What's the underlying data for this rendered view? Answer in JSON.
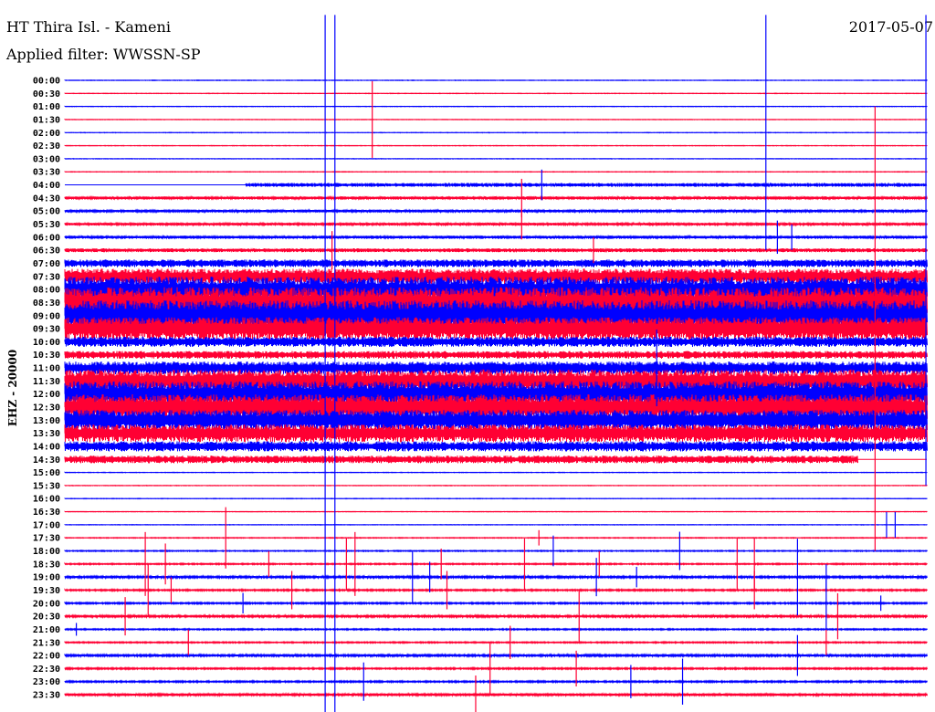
{
  "header": {
    "station": "HT Thira Isl. - Kameni",
    "filter": "Applied filter: WWSSN-SP",
    "date": "2017-05-07"
  },
  "chart_data": {
    "type": "line",
    "title": "HT Thira Isl. - Kameni",
    "subtitle": "Applied filter: WWSSN-SP",
    "ylabel": "EHZ - 20000",
    "x_range_minutes": [
      0,
      30
    ],
    "colors": [
      "#0000ff",
      "#ff0033"
    ],
    "row_labels": [
      "00:00",
      "00:30",
      "01:00",
      "01:30",
      "02:00",
      "02:30",
      "03:00",
      "03:30",
      "04:00",
      "04:30",
      "05:00",
      "05:30",
      "06:00",
      "06:30",
      "07:00",
      "07:30",
      "08:00",
      "08:30",
      "09:00",
      "09:30",
      "10:00",
      "10:30",
      "11:00",
      "11:30",
      "12:00",
      "12:30",
      "13:00",
      "13:30",
      "14:00",
      "14:30",
      "15:00",
      "15:30",
      "16:00",
      "16:30",
      "17:00",
      "17:30",
      "18:00",
      "18:30",
      "19:00",
      "19:30",
      "20:00",
      "20:30",
      "21:00",
      "21:30",
      "22:00",
      "22:30",
      "23:00",
      "23:30"
    ],
    "noise_amplitude": [
      0.02,
      0.02,
      0.02,
      0.02,
      0.02,
      0.02,
      0.02,
      0.02,
      0.15,
      0.12,
      0.1,
      0.1,
      0.12,
      0.15,
      0.3,
      0.6,
      1.0,
      1.2,
      1.2,
      0.9,
      0.4,
      0.3,
      0.5,
      0.9,
      1.0,
      1.0,
      0.8,
      0.7,
      0.4,
      0.3,
      0.02,
      0.02,
      0.02,
      0.02,
      0.02,
      0.03,
      0.04,
      0.05,
      0.08,
      0.06,
      0.06,
      0.08,
      0.05,
      0.05,
      0.08,
      0.06,
      0.06,
      0.1
    ],
    "noisy_span_minutes": {
      "8": [
        6.3,
        30
      ],
      "29": [
        0,
        27.6
      ]
    },
    "long_signals": [
      {
        "minute": 9.06,
        "from_row": -5,
        "to_row": 49,
        "color": 0
      },
      {
        "minute": 9.4,
        "from_row": -5,
        "to_row": 49,
        "color": 0
      },
      {
        "minute": 24.4,
        "from_row": -5,
        "to_row": 13,
        "color": 0
      },
      {
        "minute": 29.97,
        "from_row": -5,
        "to_row": 31,
        "color": 0
      },
      {
        "minute": 28.2,
        "from_row": 2,
        "to_row": 36,
        "color": 1
      }
    ],
    "events": [
      [
        3,
        10.7,
        3
      ],
      [
        8,
        16.6,
        1.2
      ],
      [
        9,
        15.9,
        1.5
      ],
      [
        11,
        15.9,
        1.2
      ],
      [
        12,
        24.8,
        1.3
      ],
      [
        12,
        25.3,
        1
      ],
      [
        13,
        9.3,
        1.5
      ],
      [
        13,
        18.4,
        1
      ],
      [
        22,
        20.6,
        3
      ],
      [
        34,
        28.6,
        1
      ],
      [
        34,
        28.9,
        1
      ],
      [
        35,
        5.6,
        2.4
      ],
      [
        35,
        16.5,
        0.6
      ],
      [
        36,
        17.0,
        1.2
      ],
      [
        36,
        21.4,
        1.5
      ],
      [
        37,
        2.8,
        2.5
      ],
      [
        37,
        3.5,
        1.6
      ],
      [
        37,
        7.1,
        1
      ],
      [
        37,
        9.8,
        2
      ],
      [
        37,
        10.1,
        2.5
      ],
      [
        37,
        13.1,
        1.2
      ],
      [
        37,
        16.0,
        2
      ],
      [
        37,
        18.6,
        1
      ],
      [
        37,
        23.4,
        2
      ],
      [
        37,
        24.0,
        2
      ],
      [
        38,
        12.1,
        2
      ],
      [
        38,
        12.7,
        1.2
      ],
      [
        38,
        18.5,
        1.5
      ],
      [
        38,
        19.9,
        0.8
      ],
      [
        38,
        25.5,
        3
      ],
      [
        38,
        26.5,
        1
      ],
      [
        39,
        2.9,
        2
      ],
      [
        39,
        3.7,
        1
      ],
      [
        39,
        7.9,
        1.5
      ],
      [
        39,
        13.3,
        1.5
      ],
      [
        39,
        24.0,
        1.5
      ],
      [
        40,
        6.2,
        0.8
      ],
      [
        40,
        26.5,
        2
      ],
      [
        40,
        28.4,
        0.6
      ],
      [
        41,
        2.1,
        1.5
      ],
      [
        41,
        17.9,
        2
      ],
      [
        41,
        26.9,
        1.8
      ],
      [
        42,
        0.4,
        0.5
      ],
      [
        43,
        4.3,
        1
      ],
      [
        43,
        15.5,
        1.3
      ],
      [
        43,
        26.5,
        1
      ],
      [
        44,
        25.5,
        1.6
      ],
      [
        45,
        14.8,
        2
      ],
      [
        45,
        17.8,
        1.4
      ],
      [
        46,
        10.4,
        1.5
      ],
      [
        46,
        21.5,
        1.8
      ],
      [
        47,
        14.3,
        1.5
      ],
      [
        46,
        19.7,
        1.3
      ]
    ]
  }
}
